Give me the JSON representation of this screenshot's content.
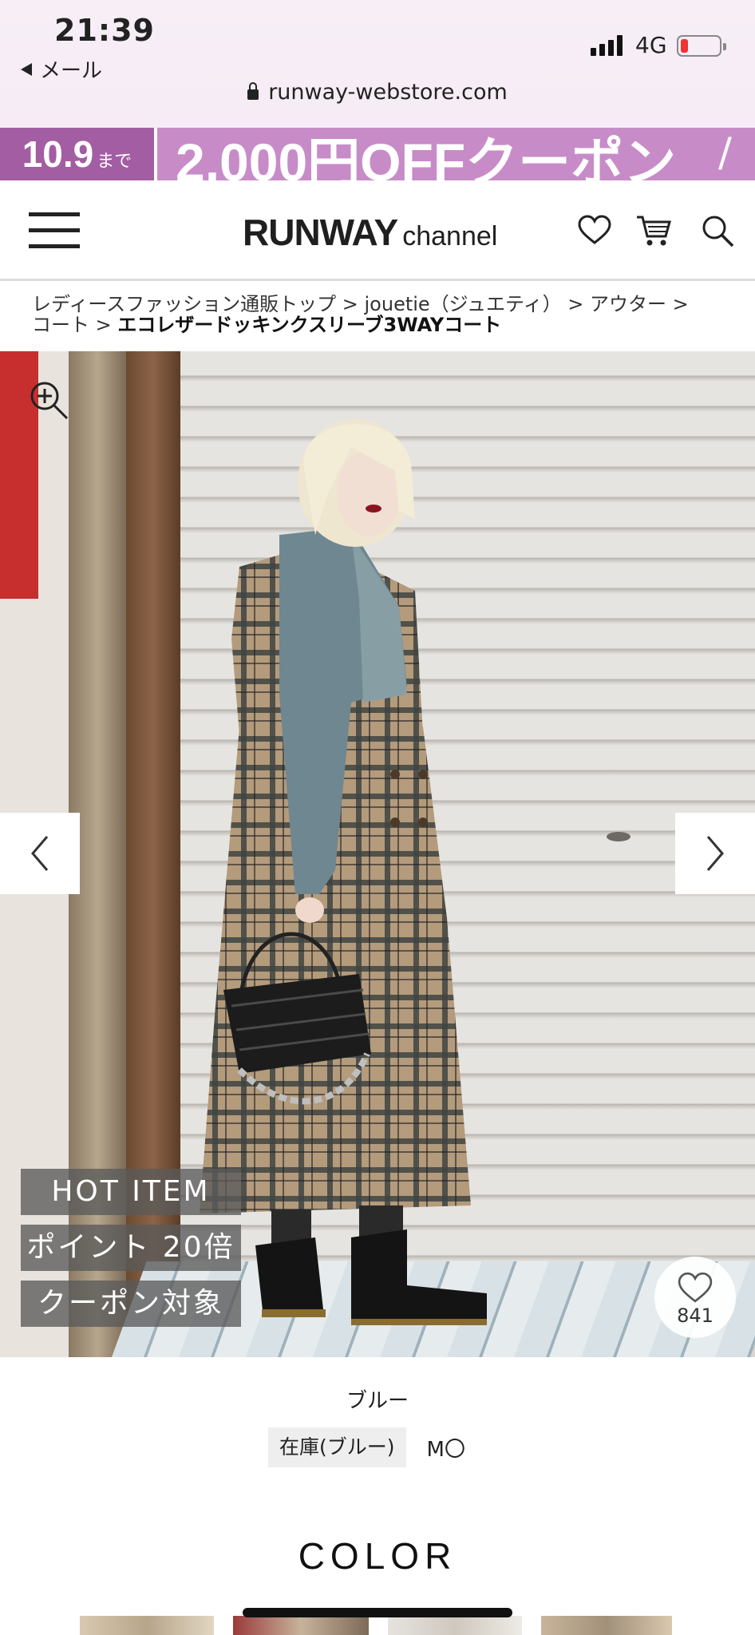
{
  "status_bar": {
    "time": "21:39",
    "back_app": "メール",
    "network": "4G"
  },
  "address_bar": {
    "url": "runway-webstore.com"
  },
  "banner": {
    "date": "10.9",
    "date_suffix": "まで",
    "text": "2,000円OFFクーポン",
    "accent_color": "#c78cc8"
  },
  "header": {
    "logo_main": "RUNWAY",
    "logo_sub": "channel"
  },
  "breadcrumb": {
    "items": [
      "レディースファッション通販トップ",
      "jouetie（ジュエティ）",
      "アウター",
      "コート"
    ],
    "separator": ">",
    "current": "エコレザードッキンクスリーブ3WAYコート"
  },
  "product": {
    "badges": [
      "HOT ITEM",
      "ポイント 20倍",
      "クーポン対象"
    ],
    "favorites_count": "841",
    "color_name": "ブルー",
    "stock_label": "在庫(ブルー)",
    "stock_sizes": "M〇"
  },
  "color_section": {
    "heading": "COLOR"
  },
  "icons": {
    "menu": "hamburger-icon",
    "favorite": "heart-icon",
    "cart": "cart-icon",
    "search": "search-icon",
    "zoom": "zoom-in-icon",
    "prev": "chevron-left-icon",
    "next": "chevron-right-icon",
    "lock": "lock-icon"
  }
}
